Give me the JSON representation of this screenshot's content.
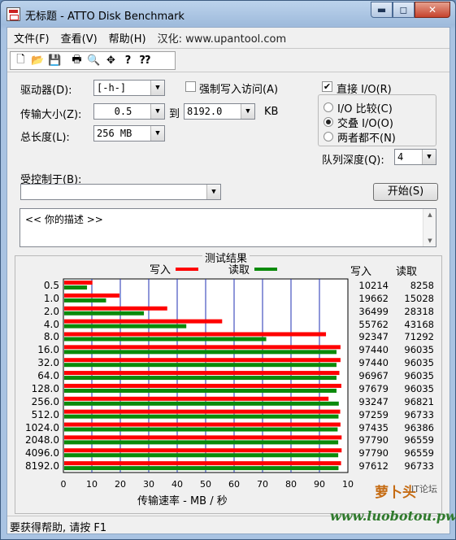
{
  "window": {
    "title": "无标题 - ATTO Disk Benchmark"
  },
  "caption_buttons": {
    "minimize": "▬",
    "maximize": "◻",
    "close": "✕"
  },
  "menu": [
    "文件(F)",
    "查看(V)",
    "帮助(H)",
    "汉化: www.upantool.com"
  ],
  "toolbar": {
    "icons": [
      "new-icon",
      "open-icon",
      "save-icon",
      "print-icon",
      "print-preview-icon",
      "move-icon",
      "help-icon",
      "context-help-icon"
    ],
    "glyphs": {
      "new": "🗋",
      "open": "📂",
      "save": "💾",
      "print": "🖶",
      "preview": "🔍",
      "move": "✥",
      "help": "?",
      "context_help": "⁇"
    }
  },
  "settings": {
    "drive_label": "驱动器(D):",
    "drive_value": "[-h-]",
    "force_write_label": "强制写入访问(A)",
    "direct_io_label": "直接 I/O(R)",
    "transfer_size_label": "传输大小(Z):",
    "transfer_from": "0.5",
    "to_label": "到",
    "transfer_to": "8192.0",
    "kb_label": "KB",
    "total_length_label": "总长度(L):",
    "total_length_value": "256 MB",
    "io_compare_label": "I/O 比较(C)",
    "overlap_io_label": "交叠 I/O(O)",
    "neither_label": "两者都不(N)",
    "queue_depth_label": "队列深度(Q):",
    "queue_depth_value": "4",
    "controlled_by_label": "受控制于(B):",
    "controlled_by_value": "",
    "start_button": "开始(S)",
    "description": "<<  你的描述  >>"
  },
  "results": {
    "title": "测试结果",
    "legend_write": "写入",
    "legend_read": "读取",
    "col_write": "写入",
    "col_read": "读取",
    "write_color": "#ff0000",
    "read_color": "#0a8a0a",
    "rows": [
      {
        "size": "0.5",
        "write": "10214",
        "read": "8258"
      },
      {
        "size": "1.0",
        "write": "19662",
        "read": "15028"
      },
      {
        "size": "2.0",
        "write": "36499",
        "read": "28318"
      },
      {
        "size": "4.0",
        "write": "55762",
        "read": "43168"
      },
      {
        "size": "8.0",
        "write": "92347",
        "read": "71292"
      },
      {
        "size": "16.0",
        "write": "97440",
        "read": "96035"
      },
      {
        "size": "32.0",
        "write": "97440",
        "read": "96035"
      },
      {
        "size": "64.0",
        "write": "96967",
        "read": "96035"
      },
      {
        "size": "128.0",
        "write": "97679",
        "read": "96035"
      },
      {
        "size": "256.0",
        "write": "93247",
        "read": "96821"
      },
      {
        "size": "512.0",
        "write": "97259",
        "read": "96733"
      },
      {
        "size": "1024.0",
        "write": "97435",
        "read": "96386"
      },
      {
        "size": "2048.0",
        "write": "97790",
        "read": "96559"
      },
      {
        "size": "4096.0",
        "write": "97790",
        "read": "96559"
      },
      {
        "size": "8192.0",
        "write": "97612",
        "read": "96733"
      }
    ],
    "axis_ticks": [
      "0",
      "10",
      "20",
      "30",
      "40",
      "50",
      "60",
      "70",
      "80",
      "90",
      "10"
    ],
    "axis_title": "传输速率 - MB / 秒"
  },
  "chart_data": {
    "type": "bar",
    "categories": [
      "0.5",
      "1.0",
      "2.0",
      "4.0",
      "8.0",
      "16.0",
      "32.0",
      "64.0",
      "128.0",
      "256.0",
      "512.0",
      "1024.0",
      "2048.0",
      "4096.0",
      "8192.0"
    ],
    "series": [
      {
        "name": "写入",
        "values": [
          10.2,
          19.7,
          36.5,
          55.8,
          92.3,
          97.4,
          97.4,
          97.0,
          97.7,
          93.2,
          97.3,
          97.4,
          97.8,
          97.8,
          97.6
        ]
      },
      {
        "name": "读取",
        "values": [
          8.3,
          15.0,
          28.3,
          43.2,
          71.3,
          96.0,
          96.0,
          96.0,
          96.0,
          96.8,
          96.7,
          96.4,
          96.6,
          96.6,
          96.7
        ]
      }
    ],
    "xlabel": "传输速率 - MB / 秒",
    "xlim": [
      0,
      100
    ],
    "orientation": "horizontal",
    "grid": true
  },
  "statusbar": {
    "text": "要获得帮助, 请按 F1"
  },
  "watermark": {
    "logo": "萝卜头",
    "sub": "IT论坛",
    "url": "www.luobotou.pw"
  }
}
